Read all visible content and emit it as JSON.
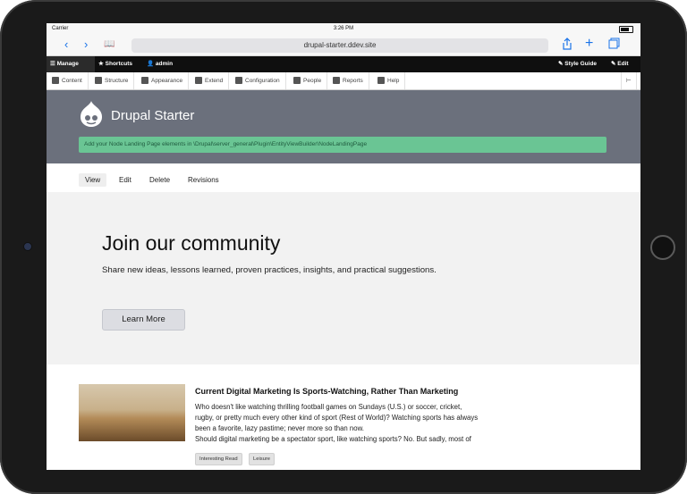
{
  "status": {
    "carrier": "Carrier",
    "time": "3:26 PM"
  },
  "browser": {
    "url": "drupal-starter.ddev.site"
  },
  "toolbar": {
    "manage": "Manage",
    "shortcuts": "Shortcuts",
    "user": "admin",
    "style_guide": "Style Guide",
    "edit": "Edit"
  },
  "tray": {
    "items": [
      "Content",
      "Structure",
      "Appearance",
      "Extend",
      "Configuration",
      "People",
      "Reports",
      "Help"
    ]
  },
  "site": {
    "name": "Drupal Starter",
    "message": "Add your Node Landing Page elements in \\Drupal\\server_general\\Plugin\\EntityViewBuilder\\NodeLandingPage"
  },
  "tabs": [
    "View",
    "Edit",
    "Delete",
    "Revisions"
  ],
  "hero": {
    "title": "Join our community",
    "subtitle": "Share new ideas, lessons learned, proven practices, insights, and practical suggestions.",
    "button": "Learn More"
  },
  "article": {
    "title": "Current Digital Marketing Is Sports-Watching, Rather Than Marketing",
    "body": [
      "Who doesn't like watching thrilling football games on Sundays (U.S.) or soccer, cricket,",
      "rugby, or pretty much every other kind of sport (Rest of World)? Watching sports has always",
      "been a favorite, lazy pastime; never more so than now.",
      "Should digital marketing be a spectator sport, like watching sports? No. But sadly, most of"
    ],
    "tags": [
      "Interesting Read",
      "Leisure"
    ]
  },
  "colors": {
    "header_bg": "#6b707c",
    "message_bg": "#6ac594",
    "toolbar_bg": "#0f0f0f"
  }
}
